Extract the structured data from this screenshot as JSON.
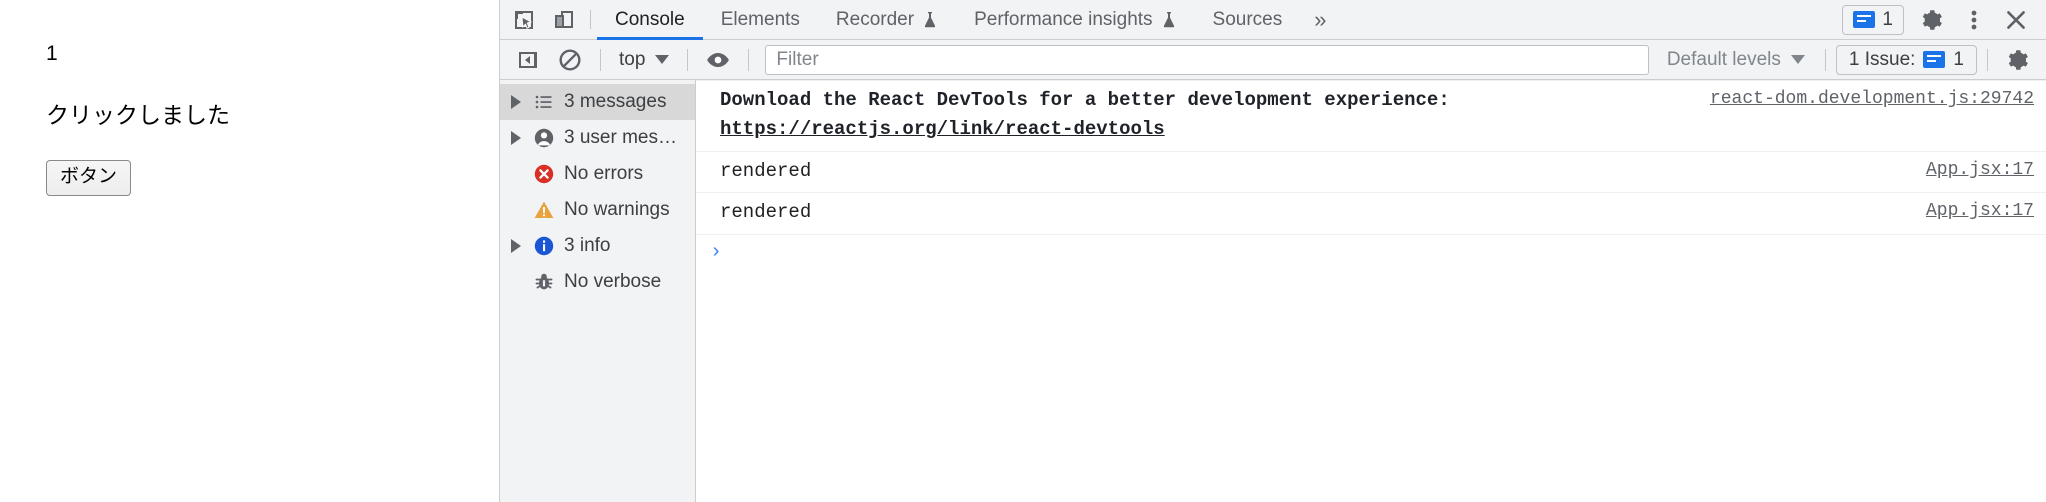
{
  "page": {
    "count": "1",
    "message": "クリックしました",
    "button_label": "ボタン"
  },
  "devtools": {
    "tabstrip": {
      "inspect_icon": "inspect-cursor-icon",
      "device_icon": "device-toolbar-icon",
      "tabs": [
        {
          "label": "Console",
          "selected": true,
          "experimental": false
        },
        {
          "label": "Elements",
          "selected": false,
          "experimental": false
        },
        {
          "label": "Recorder",
          "selected": false,
          "experimental": true
        },
        {
          "label": "Performance insights",
          "selected": false,
          "experimental": true
        },
        {
          "label": "Sources",
          "selected": false,
          "experimental": false
        }
      ],
      "overflow_label": "»",
      "issues_count": "1",
      "settings_icon": "gear-icon",
      "more_icon": "kebab-menu-icon",
      "close_icon": "close-icon"
    },
    "filterbar": {
      "sidebar_toggle_icon": "show-console-sidebar-icon",
      "clear_icon": "clear-console-icon",
      "context": "top",
      "eye_icon": "live-expression-icon",
      "filter_placeholder": "Filter",
      "filter_value": "",
      "levels": "Default levels",
      "issues_label": "1 Issue:",
      "issues_count": "1",
      "settings_icon": "gear-icon"
    },
    "sidebar": {
      "items": [
        {
          "label": "3 messages",
          "icon": "list-icon",
          "arrow": true,
          "selected": true
        },
        {
          "label": "3 user mes…",
          "icon": "user-icon",
          "arrow": true,
          "selected": false
        },
        {
          "label": "No errors",
          "icon": "error-icon",
          "arrow": false,
          "selected": false
        },
        {
          "label": "No warnings",
          "icon": "warning-icon",
          "arrow": false,
          "selected": false
        },
        {
          "label": "3 info",
          "icon": "info-icon",
          "arrow": true,
          "selected": false
        },
        {
          "label": "No verbose",
          "icon": "bug-icon",
          "arrow": false,
          "selected": false
        }
      ]
    },
    "messages": [
      {
        "text_before": "Download the React DevTools for a better development experience: ",
        "link_text": "https://reactjs.org/link/react-devtools",
        "bold": true,
        "source": "react-dom.development.js:29742"
      },
      {
        "text_before": "rendered",
        "link_text": "",
        "bold": false,
        "source": "App.jsx:17"
      },
      {
        "text_before": "rendered",
        "link_text": "",
        "bold": false,
        "source": "App.jsx:17"
      }
    ],
    "prompt_caret": "›"
  },
  "colors": {
    "accent": "#1a73e8",
    "toolbar_bg": "#f1f3f4",
    "error": "#d93025",
    "warning": "#e8a33d",
    "info": "#1a56d6",
    "selected_row": "#d8d8d8"
  }
}
